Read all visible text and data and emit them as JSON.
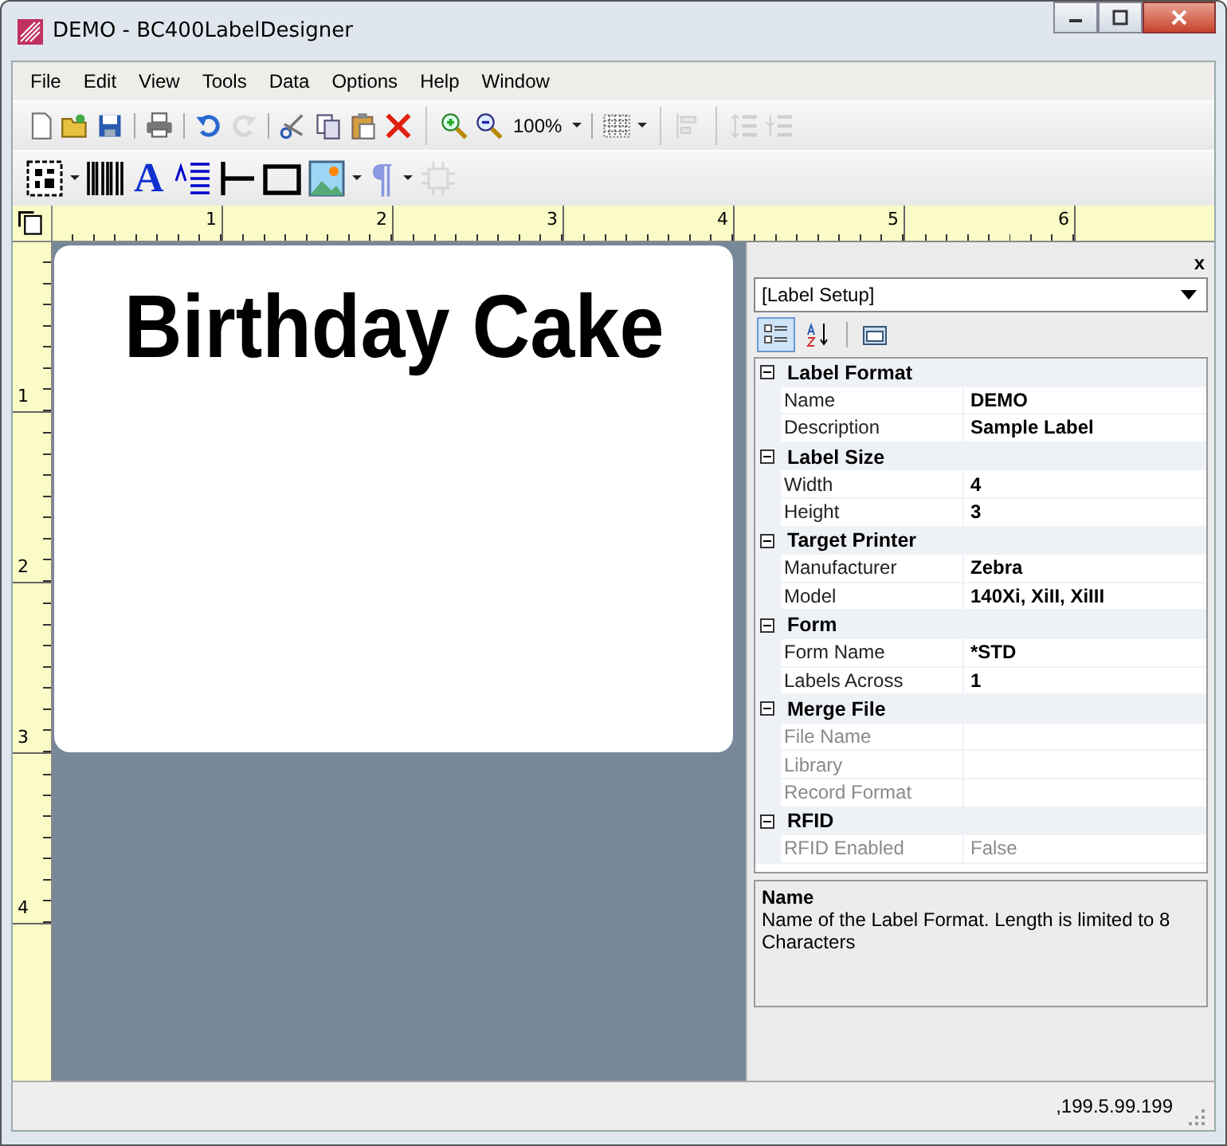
{
  "window": {
    "title": "DEMO -  BC400LabelDesigner"
  },
  "menu": [
    "File",
    "Edit",
    "View",
    "Tools",
    "Data",
    "Options",
    "Help",
    "Window"
  ],
  "toolbars": [
    [
      {
        "kind": "new",
        "disabled": false
      },
      {
        "kind": "open",
        "disabled": false
      },
      {
        "kind": "save",
        "disabled": false
      },
      {
        "kind": "sep"
      },
      {
        "kind": "print",
        "disabled": false
      },
      {
        "kind": "sep"
      },
      {
        "kind": "undo",
        "disabled": false
      },
      {
        "kind": "redo",
        "disabled": true
      },
      {
        "kind": "sep"
      },
      {
        "kind": "cut",
        "disabled": false
      },
      {
        "kind": "copy",
        "disabled": false
      },
      {
        "kind": "paste",
        "disabled": false
      },
      {
        "kind": "delete",
        "disabled": false
      },
      {
        "kind": "group"
      },
      {
        "kind": "zoom-in",
        "disabled": false
      },
      {
        "kind": "zoom-out",
        "disabled": false
      },
      {
        "kind": "zoom",
        "text": "100%",
        "disabled": false
      },
      {
        "kind": "sep"
      },
      {
        "kind": "grid",
        "disabled": false
      },
      {
        "kind": "group"
      },
      {
        "kind": "align",
        "disabled": true
      },
      {
        "kind": "group"
      },
      {
        "kind": "spacing",
        "disabled": true
      },
      {
        "kind": "spacing-out",
        "disabled": true
      }
    ],
    [
      {
        "kind": "barcode-2d",
        "disabled": false
      },
      {
        "kind": "barcode",
        "disabled": false
      },
      {
        "kind": "glyph",
        "text": "A",
        "disabled": false
      },
      {
        "kind": "text-block",
        "disabled": false
      },
      {
        "kind": "line",
        "disabled": false
      },
      {
        "kind": "rectangle",
        "disabled": false
      },
      {
        "kind": "image",
        "disabled": false
      },
      {
        "kind": "glyph-menu",
        "text": "¶",
        "disabled": true
      },
      {
        "kind": "rfid",
        "disabled": true
      }
    ]
  ],
  "ruler": {
    "horizontal": [
      "1",
      "2",
      "3",
      "4",
      "5",
      "6"
    ],
    "vertical": [
      "1",
      "2",
      "3",
      "4"
    ]
  },
  "label": {
    "text": "Birthday Cake"
  },
  "properties": {
    "close": "x",
    "selector": "[Label Setup]",
    "views": [
      {
        "kind": "categorized",
        "selected": true
      },
      {
        "kind": "alphabetical",
        "selected": false
      },
      {
        "kind": "pages",
        "selected": false
      }
    ],
    "categories": [
      {
        "name": "Label Format",
        "expanded": true,
        "rows": [
          {
            "name": "Name",
            "value": "DEMO",
            "disabled": false
          },
          {
            "name": "Description",
            "value": "Sample Label",
            "disabled": false
          }
        ]
      },
      {
        "name": "Label Size",
        "expanded": true,
        "rows": [
          {
            "name": "Width",
            "value": "4",
            "disabled": false
          },
          {
            "name": "Height",
            "value": "3",
            "disabled": false
          }
        ]
      },
      {
        "name": "Target Printer",
        "expanded": true,
        "rows": [
          {
            "name": "Manufacturer",
            "value": "Zebra",
            "disabled": false
          },
          {
            "name": "Model",
            "value": "140Xi, XiII, XiIII",
            "disabled": false
          }
        ]
      },
      {
        "name": "Form",
        "expanded": true,
        "rows": [
          {
            "name": "Form Name",
            "value": "*STD",
            "disabled": false
          },
          {
            "name": "Labels Across",
            "value": "1",
            "disabled": false
          }
        ]
      },
      {
        "name": "Merge File",
        "expanded": true,
        "rows": [
          {
            "name": "File Name",
            "disabled": true
          },
          {
            "name": "Library",
            "disabled": true
          },
          {
            "name": "Record Format",
            "disabled": true
          }
        ]
      },
      {
        "name": "RFID",
        "expanded": true,
        "rows": [
          {
            "name": "RFID Enabled",
            "value": "False",
            "disabled": true
          }
        ]
      }
    ],
    "description": {
      "title": "Name",
      "text": "Name of the Label Format.  Length is limited to 8 Characters"
    }
  },
  "status_bar": {
    "text": ",199.5.99.199"
  }
}
